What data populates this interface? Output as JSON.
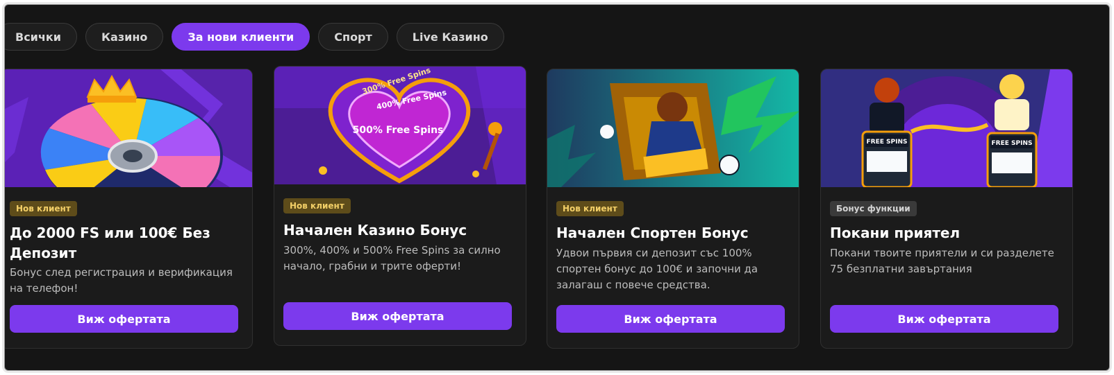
{
  "tabs": [
    "Всички",
    "Казино",
    "За нови клиенти",
    "Спорт",
    "Live Казино"
  ],
  "active_tab": "За нови клиенти",
  "colors": {
    "accent": "#7c3aed",
    "badge_new_bg": "#5e4c1a",
    "badge_new_text": "#f3cf67"
  },
  "cards": [
    {
      "badge": "Нов клиент",
      "title": "До 2000 FS или 100€ Без Депозит",
      "description": "Бонус след регистрация и верификация на телефон!",
      "cta": "Виж офертата"
    },
    {
      "badge": "Нов клиент",
      "title": "Начален Казино Бонус",
      "description": "300%, 400% и 500% Free Spins за силно начало, грабни и трите оферти!",
      "cta": "Виж офертата",
      "image_labels": [
        "300% Free Spins",
        "400% Free Spins",
        "500% Free Spins"
      ]
    },
    {
      "badge": "Нов клиент",
      "title": "Начален Спортен Бонус",
      "description": "Удвои първия си депозит със 100% спортен бонус до 100€ и започни да залагаш с повече средства.",
      "cta": "Виж офертата"
    },
    {
      "badge": "Бонус функции",
      "title": "Покани приятел",
      "description": "Покани твоите приятели и си разделете 75 безплатни завъртания",
      "cta": "Виж офертата",
      "image_labels": [
        "FREE SPINS",
        "FREE SPINS"
      ]
    }
  ]
}
